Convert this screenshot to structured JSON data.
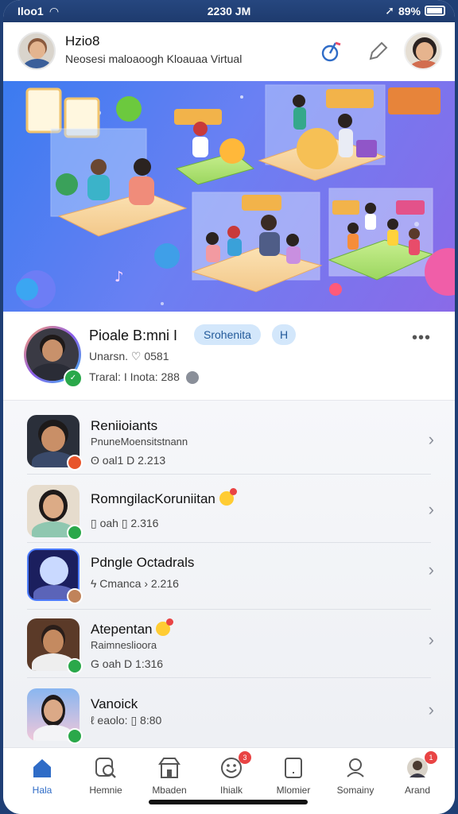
{
  "status_bar": {
    "carrier": "Iloo1",
    "time": "2230 JM",
    "battery": "89%"
  },
  "header": {
    "title": "Hzio8",
    "subtitle": "Neosesi maloaoogh Kloauaa Virtual"
  },
  "profile": {
    "name": "Pioale B:mni I",
    "tag": "Srohenita",
    "tag2": "H",
    "line2": "Unarsn.  ♡  0581",
    "line3": "Traral: I Inota: 288",
    "more": "•••"
  },
  "list": [
    {
      "title": "Reniioiants",
      "subtitle": "PnuneMoensitstnann",
      "meta": "ʘ oal1    D      2.213",
      "badge_color": "#e8552b"
    },
    {
      "title": "RomngilacKoruniitan",
      "subtitle": "",
      "meta": "▯ oah    ▯ 2.316",
      "badge_color": "#2aa84a",
      "emoji": true
    },
    {
      "title": "Pdngle Octadrals",
      "subtitle": "",
      "meta": "ϟ Cmanca   › 2.216",
      "badge_color": "#c0835a"
    },
    {
      "title": "Atepentan",
      "subtitle": "Raimneslioora",
      "meta": "G oah    D      1:316",
      "badge_color": "#2aa84a",
      "emoji": true
    },
    {
      "title": "Vanoick",
      "subtitle": "",
      "meta": "ℓ eaolo: ▯ 8:80",
      "badge_color": "#2aa84a"
    }
  ],
  "tabs": [
    {
      "label": "Hala",
      "icon": "home-icon"
    },
    {
      "label": "Hemnie",
      "icon": "search-icon"
    },
    {
      "label": "Mbaden",
      "icon": "store-icon"
    },
    {
      "label": "Ihialk",
      "icon": "smile-icon",
      "badge": "3"
    },
    {
      "label": "Mlomier",
      "icon": "device-icon"
    },
    {
      "label": "Somainy",
      "icon": "location-icon"
    },
    {
      "label": "Arand",
      "icon": "profile-icon",
      "badge": "1"
    }
  ],
  "colors": {
    "accent": "#2f6cc7",
    "pill_bg": "#d3e7fb",
    "banner_start": "#3b7bf0",
    "banner_end": "#8a6ae8"
  }
}
